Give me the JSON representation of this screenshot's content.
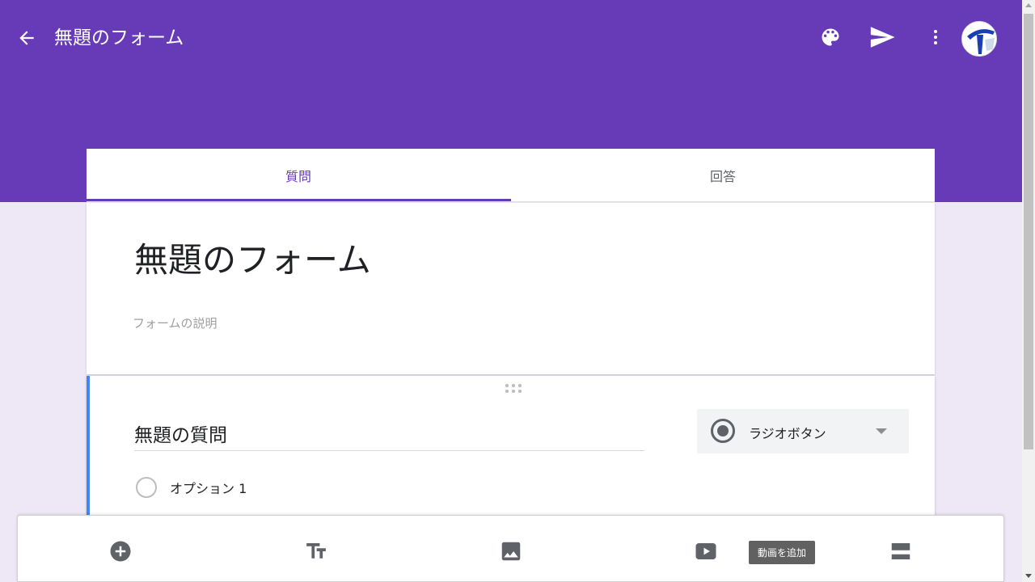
{
  "header": {
    "title": "無題のフォーム",
    "icons": [
      "back-arrow-icon",
      "palette-icon",
      "send-icon",
      "more-vert-icon",
      "avatar"
    ],
    "brand_color": "#673ab7"
  },
  "tabs": [
    {
      "label": "質問",
      "active": true
    },
    {
      "label": "回答",
      "active": false
    }
  ],
  "form": {
    "title": "無題のフォーム",
    "description_placeholder": "フォームの説明"
  },
  "question": {
    "title": "無題の質問",
    "type": "ラジオボタン",
    "options": [
      "オプション 1"
    ]
  },
  "toolbar": {
    "buttons": [
      "add-question-icon",
      "add-title-icon",
      "add-image-icon",
      "add-video-icon",
      "add-section-icon"
    ],
    "tooltip": "動画を追加"
  }
}
